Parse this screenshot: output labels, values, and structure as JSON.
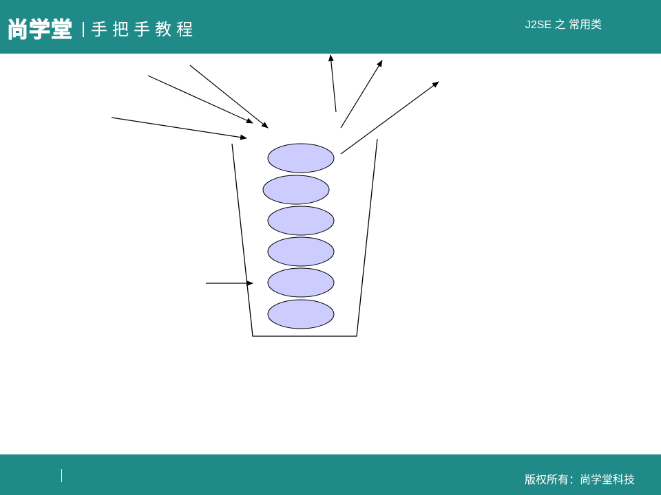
{
  "header": {
    "logo_mark": "尚学堂",
    "logo_subtitle": "手把手教程",
    "title": "J2SE 之 常用类"
  },
  "footer": {
    "copyright": "版权所有：尚学堂科技"
  },
  "colors": {
    "banner": "#1f8a87",
    "ellipse_fill": "#ccccff",
    "stroke": "#000000"
  }
}
